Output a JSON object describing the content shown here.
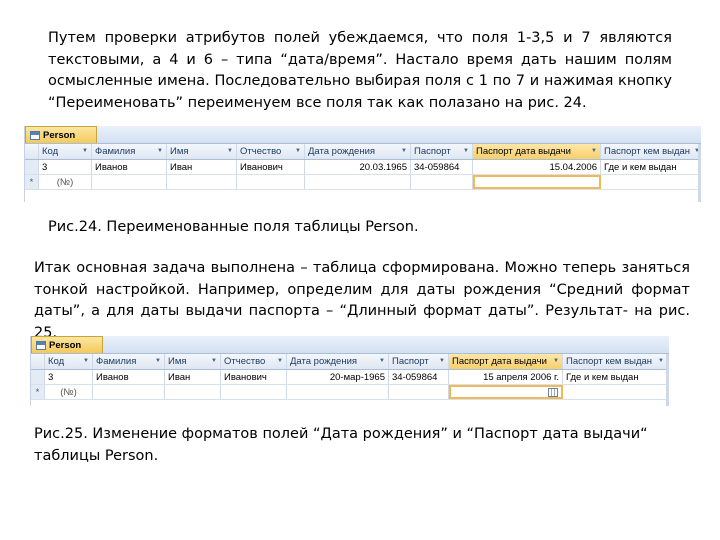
{
  "paragraph1": "Путем проверки атрибутов полей убеждаемся, что поля 1-3,5 и 7 являются текстовыми, а 4 и 6 – типа “дата/время”. Настало время дать нашим полям осмысленные имена. Последовательно выбирая поля с 1 по 7 и нажимая кнопку “Переименовать” переименуем все поля так как полазано на рис. 24.",
  "caption1": "Рис.24. Переименованные поля таблицы Person.",
  "paragraph2": "Итак основная задача выполнена – таблица сформирована.  Можно теперь заняться тонкой настройкой. Например, определим для даты рождения “Средний формат даты”, а для даты выдачи паспорта – “Длинный формат даты”. Результат- на рис. 25.",
  "caption2": "Рис.25. Изменение форматов полей “Дата рождения” и “Паспорт дата выдачи“ таблицы Person.",
  "table1": {
    "tab_label": "Person",
    "columns": [
      "Код",
      "Фамилия",
      "Имя",
      "Отчество",
      "Дата рождения",
      "Паспорт",
      "Паспорт дата выдачи",
      "Паспорт кем выдан"
    ],
    "row": [
      "3",
      "Иванов",
      "Иван",
      "Иванович",
      "20.03.1965",
      "34-059864",
      "15.04.2006",
      "Где и кем выдан"
    ],
    "new_row_label": "(№)",
    "new_row_marker": "*"
  },
  "table2": {
    "tab_label": "Person",
    "columns": [
      "Код",
      "Фамилия",
      "Имя",
      "Отчество",
      "Дата рождения",
      "Паспорт",
      "Паспорт дата выдачи",
      "Паспорт кем выдан"
    ],
    "row": [
      "3",
      "Иванов",
      "Иван",
      "Иванович",
      "20-мар-1965",
      "34-059864",
      "15 апреля 2006 г.",
      "Где и кем выдан"
    ],
    "new_row_label": "(№)",
    "new_row_marker": "*"
  },
  "colors": {
    "selected_header": "#f7cf6b",
    "grid_header": "#dfe7f2",
    "active_cell_border": "#f1b957"
  },
  "icons": [
    "table-icon",
    "dropdown-arrow-icon",
    "calendar-icon"
  ]
}
